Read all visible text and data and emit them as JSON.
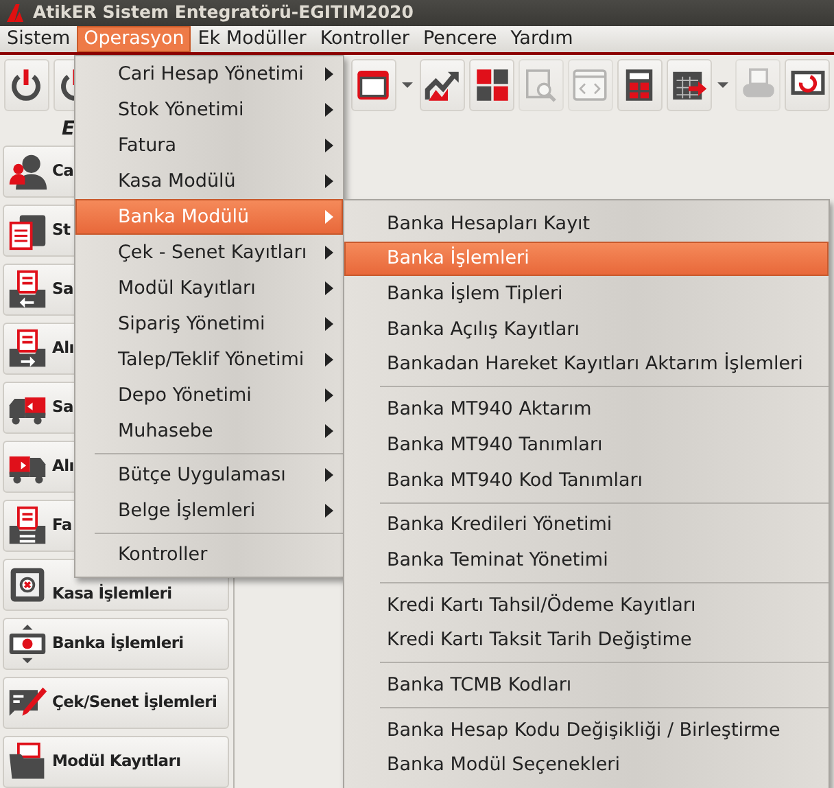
{
  "window": {
    "title": "AtikER Sistem Entegratörü-EGITIM2020"
  },
  "menubar": [
    {
      "label": "Sistem",
      "selected": false
    },
    {
      "label": "Operasyon",
      "selected": true
    },
    {
      "label": "Ek Modüller",
      "selected": false
    },
    {
      "label": "Kontroller",
      "selected": false
    },
    {
      "label": "Pencere",
      "selected": false
    },
    {
      "label": "Yardım",
      "selected": false
    }
  ],
  "toolbar": {
    "left": [
      {
        "kind": "power",
        "disabled": false
      },
      {
        "kind": "power",
        "disabled": false
      }
    ],
    "right": [
      {
        "kind": "window",
        "disabled": false
      },
      {
        "kind": "caret",
        "disabled": false
      },
      {
        "kind": "chart",
        "disabled": false
      },
      {
        "kind": "tiles",
        "disabled": false
      },
      {
        "kind": "search-doc",
        "disabled": true
      },
      {
        "kind": "code",
        "disabled": true
      },
      {
        "kind": "calculator",
        "disabled": false
      },
      {
        "kind": "calendar",
        "disabled": false
      },
      {
        "kind": "caret",
        "disabled": false
      },
      {
        "kind": "printer",
        "disabled": true
      },
      {
        "kind": "monitor",
        "disabled": false
      }
    ]
  },
  "sidebar": {
    "heading": "E",
    "buttons": [
      {
        "label": "Ca"
      },
      {
        "label": "St"
      },
      {
        "label": "Sa"
      },
      {
        "label": "Alı"
      },
      {
        "label": "Sa"
      },
      {
        "label": "Alı"
      },
      {
        "label": "Fa"
      },
      {
        "label": "Kasa İşlemleri"
      },
      {
        "label": "Banka İşlemleri"
      },
      {
        "label": "Çek/Senet İşlemleri"
      },
      {
        "label": "Modül Kayıtları"
      }
    ]
  },
  "menu": [
    {
      "kind": "item",
      "label": "Cari Hesap Yönetimi",
      "submenu": true,
      "selected": false
    },
    {
      "kind": "item",
      "label": "Stok Yönetimi",
      "submenu": true,
      "selected": false
    },
    {
      "kind": "item",
      "label": "Fatura",
      "submenu": true,
      "selected": false
    },
    {
      "kind": "item",
      "label": "Kasa Modülü",
      "submenu": true,
      "selected": false
    },
    {
      "kind": "item",
      "label": "Banka Modülü",
      "submenu": true,
      "selected": true
    },
    {
      "kind": "item",
      "label": "Çek - Senet Kayıtları",
      "submenu": true,
      "selected": false
    },
    {
      "kind": "item",
      "label": "Modül Kayıtları",
      "submenu": true,
      "selected": false
    },
    {
      "kind": "item",
      "label": "Sipariş Yönetimi",
      "submenu": true,
      "selected": false
    },
    {
      "kind": "item",
      "label": "Talep/Teklif Yönetimi",
      "submenu": true,
      "selected": false
    },
    {
      "kind": "item",
      "label": "Depo Yönetimi",
      "submenu": true,
      "selected": false
    },
    {
      "kind": "item",
      "label": "Muhasebe",
      "submenu": true,
      "selected": false
    },
    {
      "kind": "separator"
    },
    {
      "kind": "item",
      "label": "Bütçe Uygulaması",
      "submenu": true,
      "selected": false
    },
    {
      "kind": "item",
      "label": "Belge İşlemleri",
      "submenu": true,
      "selected": false
    },
    {
      "kind": "separator"
    },
    {
      "kind": "item",
      "label": "Kontroller",
      "submenu": false,
      "selected": false
    }
  ],
  "submenu": [
    {
      "kind": "item",
      "label": "Banka Hesapları Kayıt",
      "submenu": false,
      "selected": false
    },
    {
      "kind": "item",
      "label": "Banka İşlemleri",
      "submenu": false,
      "selected": true
    },
    {
      "kind": "item",
      "label": "Banka İşlem Tipleri",
      "submenu": false,
      "selected": false
    },
    {
      "kind": "item",
      "label": "Banka Açılış Kayıtları",
      "submenu": false,
      "selected": false
    },
    {
      "kind": "item",
      "label": "Bankadan Hareket Kayıtları Aktarım İşlemleri",
      "submenu": false,
      "selected": false
    },
    {
      "kind": "separator"
    },
    {
      "kind": "item",
      "label": "Banka MT940 Aktarım",
      "submenu": false,
      "selected": false
    },
    {
      "kind": "item",
      "label": "Banka MT940 Tanımları",
      "submenu": false,
      "selected": false
    },
    {
      "kind": "item",
      "label": "Banka MT940 Kod Tanımları",
      "submenu": false,
      "selected": false
    },
    {
      "kind": "separator"
    },
    {
      "kind": "item",
      "label": "Banka Kredileri Yönetimi",
      "submenu": false,
      "selected": false
    },
    {
      "kind": "item",
      "label": "Banka Teminat Yönetimi",
      "submenu": false,
      "selected": false
    },
    {
      "kind": "separator"
    },
    {
      "kind": "item",
      "label": "Kredi Kartı Tahsil/Ödeme Kayıtları",
      "submenu": false,
      "selected": false
    },
    {
      "kind": "item",
      "label": "Kredi Kartı Taksit Tarih Değiştime",
      "submenu": false,
      "selected": false
    },
    {
      "kind": "separator"
    },
    {
      "kind": "item",
      "label": "Banka TCMB Kodları",
      "submenu": false,
      "selected": false
    },
    {
      "kind": "separator"
    },
    {
      "kind": "item",
      "label": "Banka Hesap Kodu Değişikliği / Birleştirme",
      "submenu": false,
      "selected": false
    },
    {
      "kind": "item",
      "label": "Banka Modül Seçenekleri",
      "submenu": false,
      "selected": false
    }
  ]
}
